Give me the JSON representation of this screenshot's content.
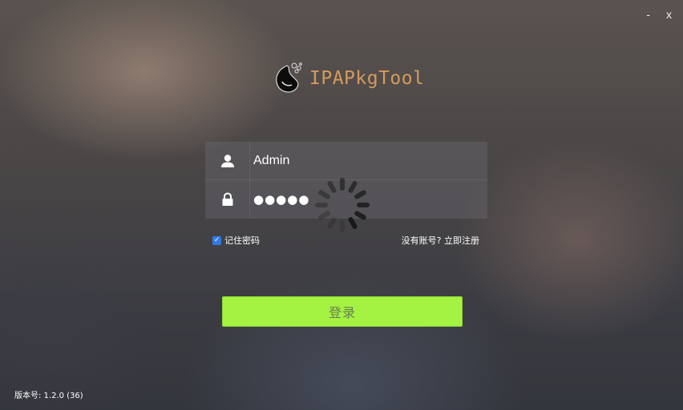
{
  "window": {
    "minimize_label": "-",
    "close_label": "x"
  },
  "brand": {
    "title": "IPAPkgTool",
    "title_color": "#d59a5e",
    "logo_icon": "ink-drop-logo"
  },
  "form": {
    "username": {
      "icon": "user-icon",
      "value": "Admin"
    },
    "password": {
      "icon": "lock-icon",
      "masked_value": "●●●●●"
    },
    "loading_icon": "spinner-icon"
  },
  "remember": {
    "label": "记住密码",
    "checked": true,
    "check_color": "#2f7ae5"
  },
  "register": {
    "label": "没有账号? 立即注册"
  },
  "login_button": {
    "label": "登录",
    "color": "#a4f242"
  },
  "footer": {
    "version": "版本号: 1.2.0 (36)"
  }
}
